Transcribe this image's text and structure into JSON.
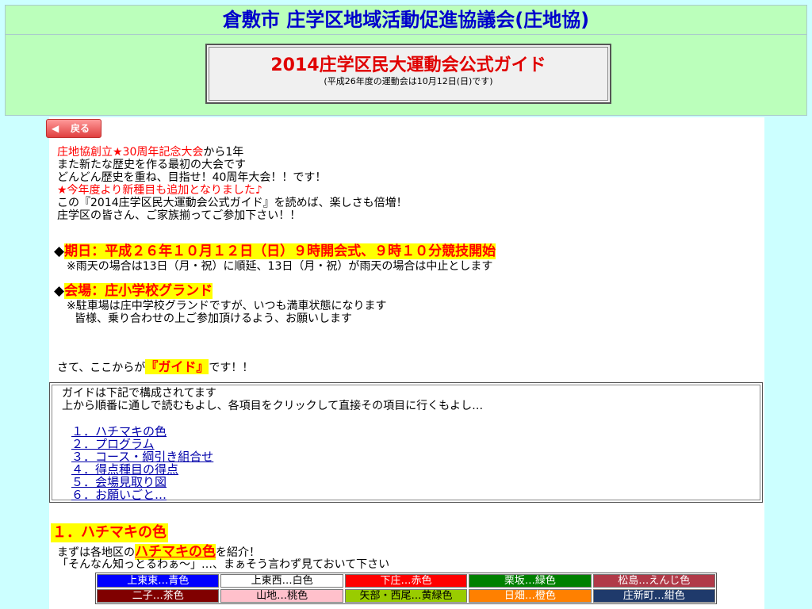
{
  "header": {
    "site_title": "倉敷市 庄学区地域活動促進協議会(庄地協)",
    "guide_title": "2014庄学区民大運動会公式ガイド",
    "guide_subtitle": "(平成26年度の運動会は10月12日(日)です)"
  },
  "nav": {
    "back_label": "戻る",
    "back_arrow": "◀"
  },
  "intro": {
    "line1_red": "庄地協創立★30周年記念大会",
    "line1_rest": "から1年",
    "line2": "また新たな歴史を作る最初の大会です",
    "line3": "どんどん歴史を重ね、目指せ！40周年大会！！です！",
    "line4_red": "★今年度より新種目も追加となりました♪",
    "line5": "この『2014庄学区民大運動会公式ガイド』を読めば、楽しさも倍増！",
    "line6": "庄学区の皆さん、ご家族揃ってご参加下さい！！"
  },
  "date": {
    "bullet": "◆",
    "heading": "期日：平成２６年１０月１２日（日）９時開会式、９時１０分競技開始",
    "note": "※雨天の場合は13日（月・祝）に順延、13日（月・祝）が雨天の場合は中止とします"
  },
  "venue": {
    "bullet": "◆",
    "heading": "会場：庄小学校グランド",
    "note1": "※駐車場は庄中学校グランドですが、いつも満車状態になります",
    "note2": "皆様、乗り合わせの上ご参加頂けるよう、お願いします"
  },
  "guide_intro": {
    "pre": "さて、ここからが",
    "highlight": "『ガイド』",
    "post": "です！！"
  },
  "toc": {
    "line1": "ガイドは下記で構成されてます",
    "line2": "上から順番に通しで読むもよし、各項目をクリックして直接その項目に行くもよし…",
    "items": [
      "１．ハチマキの色",
      "２．プログラム",
      "３．コース・綱引き組合せ",
      "４．得点種目の得点",
      "５．会場見取り図",
      "６．お願いごと…"
    ]
  },
  "section1": {
    "heading": "１．ハチマキの色",
    "line1_pre": "まずは各地区の",
    "line1_hl": "ハチマキの色",
    "line1_post": "を紹介！",
    "line2": "「そんなん知っとるわぁ～」…、まぁそう言わず見ておいて下さい",
    "colors": [
      {
        "label": "上東東…青色",
        "bg": "#0000ff",
        "fg": "#ffffff"
      },
      {
        "label": "上東西…白色",
        "bg": "#ffffff",
        "fg": "#000000"
      },
      {
        "label": "下庄…赤色",
        "bg": "#ff0000",
        "fg": "#ffffff"
      },
      {
        "label": "栗坂…緑色",
        "bg": "#008000",
        "fg": "#ffffff"
      },
      {
        "label": "松島…えんじ色",
        "bg": "#b03a48",
        "fg": "#ffffff"
      },
      {
        "label": "二子…茶色",
        "bg": "#800000",
        "fg": "#ffffff"
      },
      {
        "label": "山地…桃色",
        "bg": "#ffc0cb",
        "fg": "#000000"
      },
      {
        "label": "矢部・西尾…黄緑色",
        "bg": "#99cc00",
        "fg": "#000000"
      },
      {
        "label": "日畑…橙色",
        "bg": "#ff8000",
        "fg": "#ffffff"
      },
      {
        "label": "庄新町…紺色",
        "bg": "#1f3a6b",
        "fg": "#ffffff"
      }
    ]
  }
}
